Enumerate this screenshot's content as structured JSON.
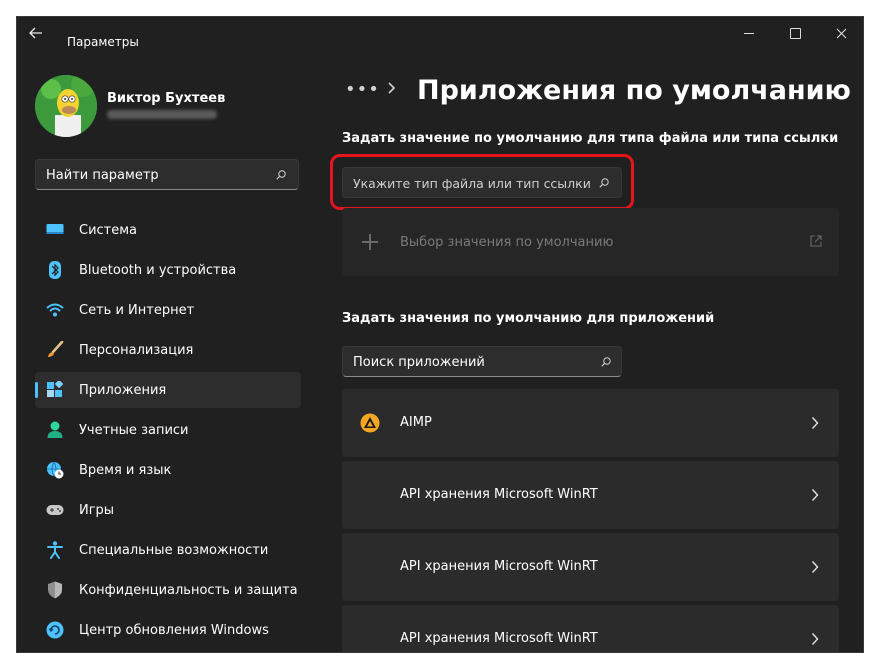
{
  "window": {
    "title": "Параметры",
    "back_icon": "arrow-left-icon",
    "controls": [
      "minimize-icon",
      "maximize-icon",
      "close-icon"
    ]
  },
  "user": {
    "name": "Виктор Бухтеев"
  },
  "sidebar": {
    "search_placeholder": "Найти параметр",
    "items": [
      {
        "label": "Система",
        "icon": "display-icon"
      },
      {
        "label": "Bluetooth и устройства",
        "icon": "bluetooth-icon"
      },
      {
        "label": "Сеть и Интернет",
        "icon": "wifi-icon"
      },
      {
        "label": "Персонализация",
        "icon": "brush-icon"
      },
      {
        "label": "Приложения",
        "icon": "apps-icon",
        "active": true
      },
      {
        "label": "Учетные записи",
        "icon": "person-icon"
      },
      {
        "label": "Время и язык",
        "icon": "globe-clock-icon"
      },
      {
        "label": "Игры",
        "icon": "gamepad-icon"
      },
      {
        "label": "Специальные возможности",
        "icon": "accessibility-icon"
      },
      {
        "label": "Конфиденциальность и защита",
        "icon": "shield-icon"
      },
      {
        "label": "Центр обновления Windows",
        "icon": "update-icon"
      }
    ]
  },
  "main": {
    "breadcrumb_more": "•••",
    "page_title": "Приложения по умолчанию",
    "filetype_section_title": "Задать значение по умолчанию для типа файла или типа ссылки",
    "filetype_search_placeholder": "Укажите тип файла или тип ссылки",
    "default_picker_label": "Выбор значения по умолчанию",
    "apps_section_title": "Задать значения по умолчанию для приложений",
    "app_search_placeholder": "Поиск приложений",
    "apps": [
      {
        "name": "AIMP",
        "icon": "aimp-icon"
      },
      {
        "name": "API хранения Microsoft WinRT"
      },
      {
        "name": "API хранения Microsoft WinRT"
      },
      {
        "name": "API хранения Microsoft WinRT"
      }
    ]
  },
  "colors": {
    "background": "#202020",
    "accent": "#4cc2ff",
    "highlight_border": "#e8141c"
  }
}
